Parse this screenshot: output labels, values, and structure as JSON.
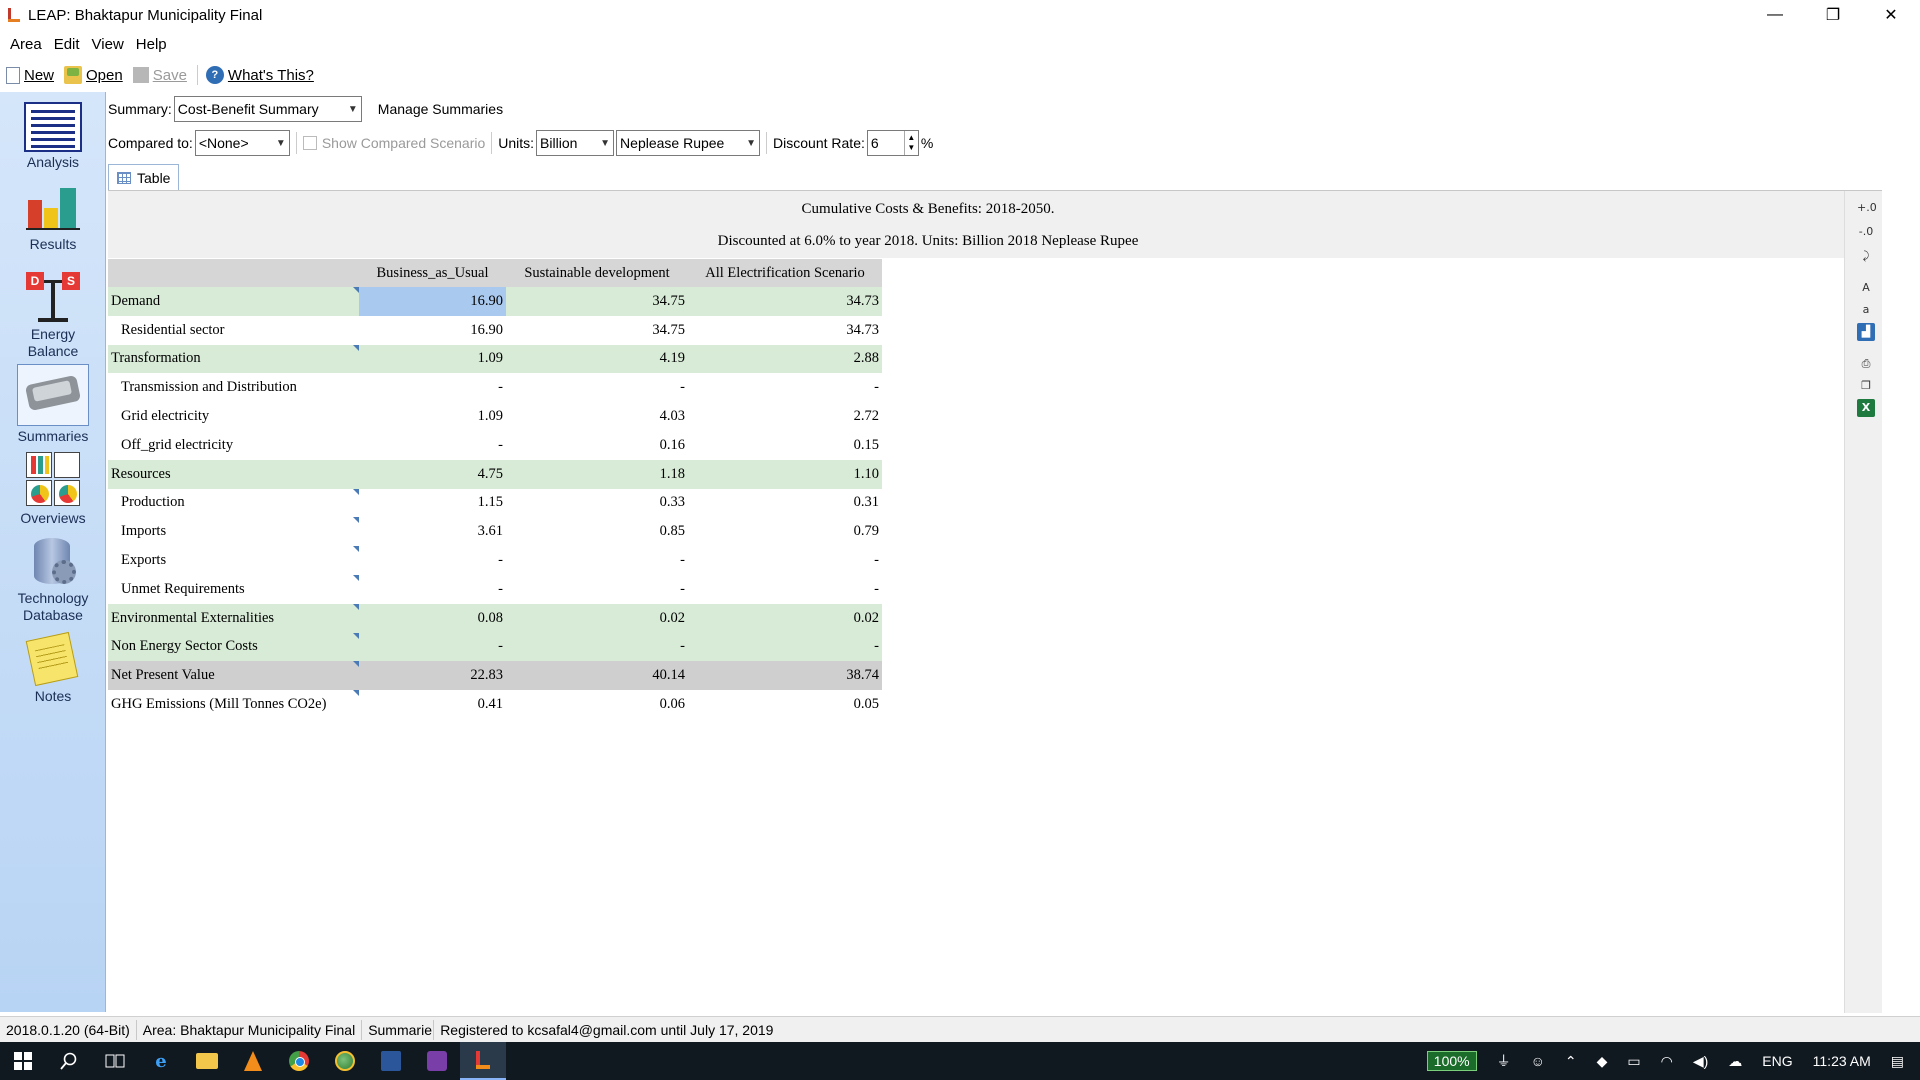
{
  "window": {
    "title": "LEAP: Bhaktapur Municipality Final",
    "minimize": "—",
    "restore": "❐",
    "close": "✕"
  },
  "menu": [
    "Area",
    "Edit",
    "View",
    "Help"
  ],
  "toolbar": {
    "new_label": "New",
    "open_label": "Open",
    "save_label": "Save",
    "whats_this_label": "What's This?"
  },
  "sidebar": {
    "items": [
      {
        "label": "Analysis",
        "icon": "analysis-icon"
      },
      {
        "label": "Results",
        "icon": "results-icon"
      },
      {
        "label": "Energy Balance",
        "icon": "energy-balance-icon"
      },
      {
        "label": "Summaries",
        "icon": "summaries-icon",
        "active": true
      },
      {
        "label": "Overviews",
        "icon": "overviews-icon"
      },
      {
        "label": "Technology Database",
        "icon": "technology-database-icon"
      },
      {
        "label": "Notes",
        "icon": "notes-icon"
      }
    ]
  },
  "controls": {
    "summary_label": "Summary:",
    "summary_value": "Cost-Benefit Summary",
    "manage_summaries": "Manage Summaries",
    "compared_to_label": "Compared to:",
    "compared_to_value": "<None>",
    "show_compared_scenario": "Show Compared Scenario",
    "units_label": "Units:",
    "units_value": "Billion",
    "currency_value": "Neplease Rupee",
    "discount_rate_label": "Discount Rate:",
    "discount_rate_value": "6",
    "percent_sign": "%"
  },
  "tabs": [
    {
      "label": "Table",
      "active": true
    }
  ],
  "report": {
    "title_line1": "Cumulative Costs & Benefits: 2018-2050.",
    "title_line2": "Discounted at 6.0% to year 2018.  Units: Billion 2018 Neplease Rupee"
  },
  "table": {
    "columns": [
      "",
      "Business_as_Usual",
      "Sustainable development",
      "All Electrification Scenario"
    ],
    "rows": [
      {
        "label": "Demand",
        "level": 0,
        "values": [
          "16.90",
          "34.75",
          "34.73"
        ],
        "marked": true
      },
      {
        "label": "Residential sector",
        "level": 1,
        "values": [
          "16.90",
          "34.75",
          "34.73"
        ],
        "marked": false
      },
      {
        "label": "Transformation",
        "level": 0,
        "values": [
          "1.09",
          "4.19",
          "2.88"
        ],
        "marked": true
      },
      {
        "label": "Transmission and Distribution",
        "level": 1,
        "values": [
          "-",
          "-",
          "-"
        ],
        "marked": false
      },
      {
        "label": "Grid electricity",
        "level": 1,
        "values": [
          "1.09",
          "4.03",
          "2.72"
        ],
        "marked": false
      },
      {
        "label": "Off_grid electricity",
        "level": 1,
        "values": [
          "-",
          "0.16",
          "0.15"
        ],
        "marked": false
      },
      {
        "label": "Resources",
        "level": 0,
        "values": [
          "4.75",
          "1.18",
          "1.10"
        ],
        "marked": false
      },
      {
        "label": "Production",
        "level": 1,
        "values": [
          "1.15",
          "0.33",
          "0.31"
        ],
        "marked": true
      },
      {
        "label": "Imports",
        "level": 1,
        "values": [
          "3.61",
          "0.85",
          "0.79"
        ],
        "marked": true
      },
      {
        "label": "Exports",
        "level": 1,
        "values": [
          "-",
          "-",
          "-"
        ],
        "marked": true
      },
      {
        "label": "Unmet Requirements",
        "level": 1,
        "values": [
          "-",
          "-",
          "-"
        ],
        "marked": true
      },
      {
        "label": "Environmental Externalities",
        "level": 0,
        "values": [
          "0.08",
          "0.02",
          "0.02"
        ],
        "marked": true
      },
      {
        "label": "Non Energy Sector Costs",
        "level": 0,
        "values": [
          "-",
          "-",
          "-"
        ],
        "marked": true
      },
      {
        "label": "Net Present Value",
        "level": "npv",
        "values": [
          "22.83",
          "40.14",
          "38.74"
        ],
        "marked": true
      },
      {
        "label": "GHG Emissions (Mill Tonnes CO2e)",
        "level": "plain",
        "values": [
          "0.41",
          "0.06",
          "0.05"
        ],
        "marked": true
      }
    ],
    "selected_cell": {
      "row": 0,
      "col": 1
    }
  },
  "right_tools": [
    {
      "icon": "increase-decimals-icon",
      "glyph": "+.0"
    },
    {
      "icon": "decrease-decimals-icon",
      "glyph": "-.0"
    },
    {
      "icon": "wrap-icon",
      "glyph": "⤸"
    },
    {
      "icon": "font-larger-icon",
      "glyph": "A"
    },
    {
      "icon": "font-smaller-icon",
      "glyph": "a"
    },
    {
      "icon": "chart-icon",
      "glyph": "▟"
    },
    {
      "icon": "print-icon",
      "glyph": "⎙"
    },
    {
      "icon": "copy-icon",
      "glyph": "❐"
    },
    {
      "icon": "excel-icon",
      "glyph": "X"
    }
  ],
  "statusbar": {
    "version": "2018.0.1.20 (64-Bit)",
    "area": "Area: Bhaktapur Municipality Final",
    "view": "Summarie",
    "registration": "Registered to kcsafal4@gmail.com until July 17, 2019"
  },
  "taskbar": {
    "battery": "100%",
    "language": "ENG",
    "time": "11:23 AM"
  },
  "colors": {
    "sidebar_gradient_top": "#d5e6fa",
    "level0_row": "#d8ebd7",
    "npv_row": "#cfcfcf",
    "selected_cell": "#a9c9ee"
  }
}
